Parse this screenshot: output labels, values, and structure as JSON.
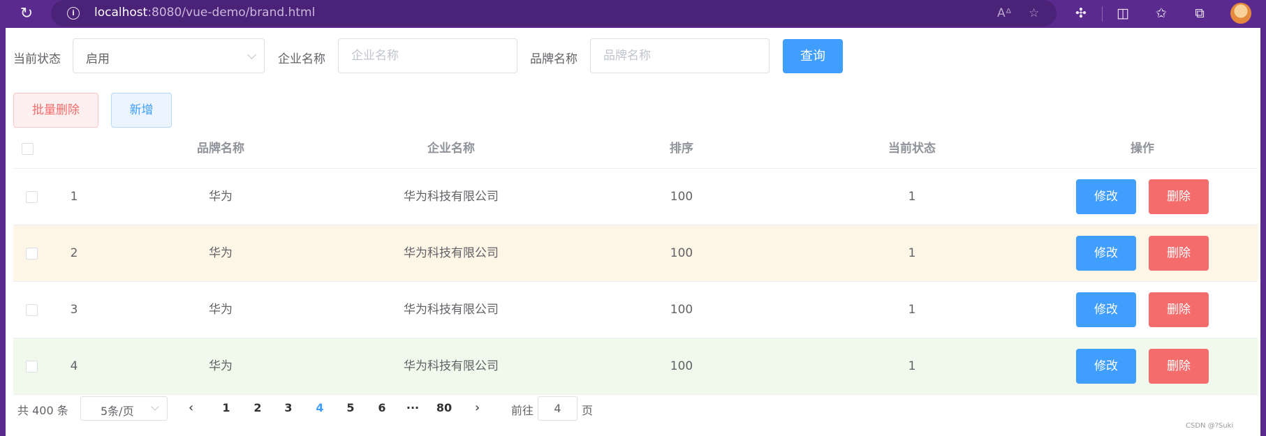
{
  "browser": {
    "url_host": "localhost",
    "url_rest": ":8080/vue-demo/brand.html"
  },
  "search": {
    "status_label": "当前状态",
    "status_value": "启用",
    "company_label": "企业名称",
    "company_placeholder": "企业名称",
    "brand_label": "品牌名称",
    "brand_placeholder": "品牌名称",
    "query_label": "查询"
  },
  "actions": {
    "batch_delete_label": "批量删除",
    "add_label": "新增"
  },
  "table": {
    "headers": {
      "brand_name": "品牌名称",
      "company_name": "企业名称",
      "ordered": "排序",
      "status": "当前状态",
      "operation": "操作"
    },
    "edit_label": "修改",
    "delete_label": "删除",
    "rows": [
      {
        "index": "1",
        "brand_name": "华为",
        "company_name": "华为科技有限公司",
        "ordered": "100",
        "status": "1"
      },
      {
        "index": "2",
        "brand_name": "华为",
        "company_name": "华为科技有限公司",
        "ordered": "100",
        "status": "1"
      },
      {
        "index": "3",
        "brand_name": "华为",
        "company_name": "华为科技有限公司",
        "ordered": "100",
        "status": "1"
      },
      {
        "index": "4",
        "brand_name": "华为",
        "company_name": "华为科技有限公司",
        "ordered": "100",
        "status": "1"
      }
    ],
    "row_colors": [
      "#ffffff",
      "#fdf5e6",
      "#ffffff",
      "#f0f9eb"
    ]
  },
  "pagination": {
    "total_text": "共 400 条",
    "page_size": "5条/页",
    "pages": [
      "1",
      "2",
      "3",
      "4",
      "5",
      "6",
      "···",
      "80"
    ],
    "current_page": "4",
    "goto_prefix": "前往",
    "goto_value": "4",
    "goto_suffix": "页"
  },
  "watermark": "CSDN @?Suki",
  "colors": {
    "primary": "#409eff",
    "danger": "#f56c6c",
    "chrome": "#5b2a8e"
  }
}
